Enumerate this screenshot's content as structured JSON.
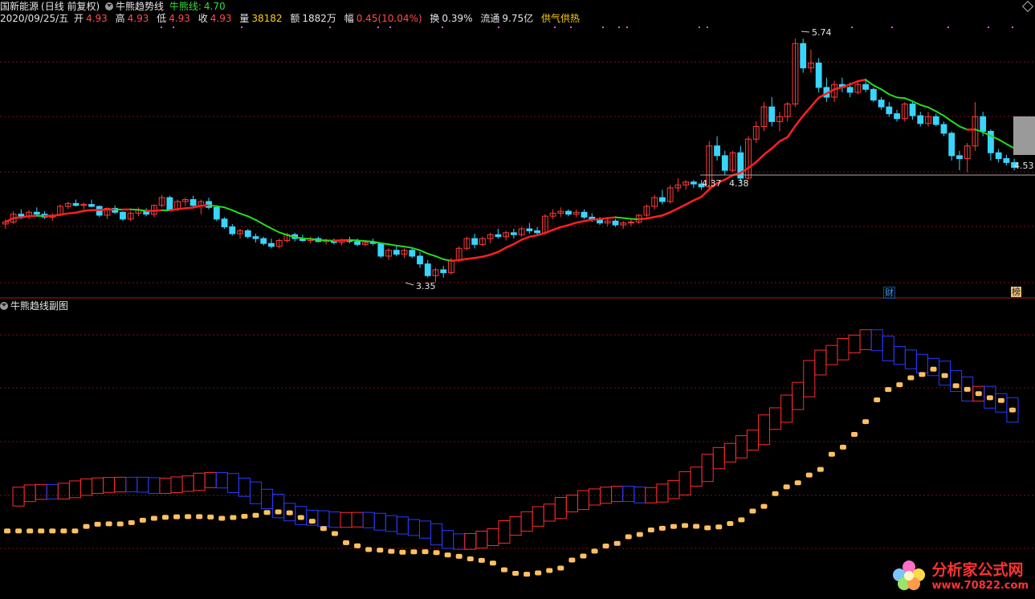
{
  "header": {
    "stock_name": "国新能源",
    "period": "(日线 前复权)",
    "indicator": "牛熊趋势线",
    "indicator_line_label": "牛熊线:",
    "indicator_line_value": "4.70",
    "date": "2020/09/25/五",
    "open_label": "开",
    "open": "4.93",
    "high_label": "高",
    "high": "4.93",
    "low_label": "低",
    "low": "4.93",
    "close_label": "收",
    "close": "4.93",
    "volume_label": "量",
    "volume": "38182",
    "amount_label": "额",
    "amount": "1882万",
    "change_label": "幅",
    "change": "0.45(10.04%)",
    "turnover_label": "换",
    "turnover": "0.39%",
    "float_label": "流通",
    "float": "9.75亿",
    "extra": "供气供热"
  },
  "sub_panel": {
    "title": "牛熊趋线副图"
  },
  "price_labels": {
    "high": "5.74",
    "low": "3.35",
    "mark_a": "4.37",
    "mark_b": "4.38",
    "last": "4.53"
  },
  "badges": {
    "cai": "财",
    "rank": "榜"
  },
  "watermark": {
    "title": "分析家公式网",
    "url": "www.70822.com"
  },
  "colors": {
    "up": "#ff3b3b",
    "down": "#39d5ff",
    "bull_line": "#ff2020",
    "bear_line": "#22dd22",
    "sub_up": "#ff2a2a",
    "sub_down": "#2a3aff",
    "sub_signal": "#ffc060",
    "grid": "#7a1414"
  },
  "chart_data": {
    "type": "candlestick",
    "y_range": [
      3.2,
      5.95
    ],
    "grid": true,
    "candles": [
      [
        3.95,
        4.0,
        3.9,
        3.97
      ],
      [
        3.97,
        4.08,
        3.95,
        4.05
      ],
      [
        4.05,
        4.1,
        4.0,
        4.03
      ],
      [
        4.03,
        4.09,
        4.0,
        4.07
      ],
      [
        4.07,
        4.12,
        4.03,
        4.05
      ],
      [
        4.05,
        4.08,
        4.0,
        4.02
      ],
      [
        4.02,
        4.06,
        3.98,
        4.04
      ],
      [
        4.04,
        4.15,
        4.03,
        4.13
      ],
      [
        4.13,
        4.18,
        4.1,
        4.16
      ],
      [
        4.16,
        4.2,
        4.13,
        4.14
      ],
      [
        4.14,
        4.17,
        4.1,
        4.15
      ],
      [
        4.15,
        4.2,
        4.12,
        4.13
      ],
      [
        4.13,
        4.14,
        4.02,
        4.04
      ],
      [
        4.04,
        4.12,
        4.0,
        4.11
      ],
      [
        4.11,
        4.14,
        4.05,
        4.07
      ],
      [
        4.07,
        4.08,
        3.98,
        4.0
      ],
      [
        4.0,
        4.08,
        3.98,
        4.06
      ],
      [
        4.06,
        4.12,
        4.03,
        4.09
      ],
      [
        4.09,
        4.11,
        4.03,
        4.05
      ],
      [
        4.05,
        4.15,
        4.02,
        4.14
      ],
      [
        4.14,
        4.25,
        4.12,
        4.22
      ],
      [
        4.22,
        4.24,
        4.08,
        4.1
      ],
      [
        4.1,
        4.2,
        4.08,
        4.18
      ],
      [
        4.18,
        4.22,
        4.13,
        4.2
      ],
      [
        4.2,
        4.24,
        4.12,
        4.14
      ],
      [
        4.14,
        4.2,
        4.05,
        4.18
      ],
      [
        4.18,
        4.22,
        4.1,
        4.12
      ],
      [
        4.12,
        4.13,
        3.98,
        4.0
      ],
      [
        4.0,
        4.02,
        3.9,
        3.92
      ],
      [
        3.92,
        3.95,
        3.83,
        3.85
      ],
      [
        3.85,
        3.9,
        3.8,
        3.88
      ],
      [
        3.88,
        3.9,
        3.8,
        3.82
      ],
      [
        3.82,
        3.85,
        3.76,
        3.8
      ],
      [
        3.8,
        3.82,
        3.73,
        3.75
      ],
      [
        3.75,
        3.8,
        3.7,
        3.72
      ],
      [
        3.72,
        3.8,
        3.7,
        3.78
      ],
      [
        3.78,
        3.86,
        3.76,
        3.84
      ],
      [
        3.84,
        3.86,
        3.77,
        3.8
      ],
      [
        3.8,
        3.84,
        3.77,
        3.78
      ],
      [
        3.78,
        3.82,
        3.75,
        3.8
      ],
      [
        3.8,
        3.82,
        3.76,
        3.77
      ],
      [
        3.77,
        3.8,
        3.74,
        3.78
      ],
      [
        3.78,
        3.8,
        3.74,
        3.76
      ],
      [
        3.76,
        3.8,
        3.73,
        3.78
      ],
      [
        3.78,
        3.82,
        3.75,
        3.77
      ],
      [
        3.77,
        3.8,
        3.72,
        3.74
      ],
      [
        3.74,
        3.78,
        3.72,
        3.76
      ],
      [
        3.76,
        3.8,
        3.73,
        3.75
      ],
      [
        3.75,
        3.76,
        3.6,
        3.62
      ],
      [
        3.62,
        3.7,
        3.58,
        3.68
      ],
      [
        3.68,
        3.72,
        3.62,
        3.64
      ],
      [
        3.64,
        3.7,
        3.6,
        3.68
      ],
      [
        3.68,
        3.7,
        3.6,
        3.62
      ],
      [
        3.62,
        3.66,
        3.5,
        3.54
      ],
      [
        3.54,
        3.58,
        3.4,
        3.42
      ],
      [
        3.42,
        3.5,
        3.35,
        3.48
      ],
      [
        3.48,
        3.52,
        3.4,
        3.45
      ],
      [
        3.45,
        3.6,
        3.43,
        3.58
      ],
      [
        3.58,
        3.72,
        3.56,
        3.7
      ],
      [
        3.7,
        3.82,
        3.68,
        3.8
      ],
      [
        3.8,
        3.85,
        3.7,
        3.74
      ],
      [
        3.74,
        3.82,
        3.72,
        3.8
      ],
      [
        3.8,
        3.86,
        3.75,
        3.84
      ],
      [
        3.84,
        3.9,
        3.8,
        3.82
      ],
      [
        3.82,
        3.88,
        3.78,
        3.86
      ],
      [
        3.86,
        3.9,
        3.8,
        3.84
      ],
      [
        3.84,
        3.92,
        3.82,
        3.9
      ],
      [
        3.9,
        3.96,
        3.85,
        3.88
      ],
      [
        3.88,
        3.92,
        3.84,
        3.86
      ],
      [
        3.86,
        4.05,
        3.84,
        4.03
      ],
      [
        4.03,
        4.1,
        4.0,
        4.06
      ],
      [
        4.06,
        4.12,
        4.02,
        4.08
      ],
      [
        4.08,
        4.1,
        4.03,
        4.05
      ],
      [
        4.05,
        4.1,
        4.02,
        4.07
      ],
      [
        4.07,
        4.1,
        4.0,
        4.02
      ],
      [
        4.02,
        4.06,
        3.97,
        3.99
      ],
      [
        3.99,
        4.02,
        3.94,
        3.96
      ],
      [
        3.96,
        4.0,
        3.93,
        3.98
      ],
      [
        3.98,
        4.0,
        3.92,
        3.94
      ],
      [
        3.94,
        3.98,
        3.9,
        3.96
      ],
      [
        3.96,
        4.0,
        3.93,
        3.97
      ],
      [
        3.97,
        4.05,
        3.95,
        4.04
      ],
      [
        4.04,
        4.15,
        4.02,
        4.13
      ],
      [
        4.13,
        4.25,
        4.1,
        4.22
      ],
      [
        4.22,
        4.3,
        4.15,
        4.18
      ],
      [
        4.18,
        4.35,
        4.16,
        4.32
      ],
      [
        4.32,
        4.42,
        4.28,
        4.35
      ],
      [
        4.35,
        4.4,
        4.3,
        4.38
      ],
      [
        4.38,
        4.4,
        4.32,
        4.36
      ],
      [
        4.36,
        4.4,
        4.3,
        4.33
      ],
      [
        4.33,
        4.8,
        4.3,
        4.75
      ],
      [
        4.75,
        4.85,
        4.6,
        4.65
      ],
      [
        4.65,
        4.7,
        4.45,
        4.5
      ],
      [
        4.5,
        4.7,
        4.48,
        4.68
      ],
      [
        4.68,
        4.75,
        4.38,
        4.42
      ],
      [
        4.42,
        4.85,
        4.4,
        4.82
      ],
      [
        4.82,
        5.0,
        4.78,
        4.95
      ],
      [
        4.95,
        5.2,
        4.9,
        5.15
      ],
      [
        5.15,
        5.25,
        4.95,
        5.0
      ],
      [
        5.0,
        5.1,
        4.9,
        5.05
      ],
      [
        5.05,
        5.2,
        5.0,
        5.18
      ],
      [
        5.18,
        5.85,
        5.15,
        5.8
      ],
      [
        5.8,
        5.85,
        5.5,
        5.55
      ],
      [
        5.55,
        5.74,
        5.5,
        5.6
      ],
      [
        5.6,
        5.65,
        5.3,
        5.35
      ],
      [
        5.35,
        5.45,
        5.2,
        5.25
      ],
      [
        5.25,
        5.42,
        5.2,
        5.38
      ],
      [
        5.38,
        5.45,
        5.3,
        5.35
      ],
      [
        5.35,
        5.4,
        5.25,
        5.3
      ],
      [
        5.3,
        5.42,
        5.28,
        5.38
      ],
      [
        5.38,
        5.42,
        5.3,
        5.33
      ],
      [
        5.33,
        5.35,
        5.2,
        5.22
      ],
      [
        5.22,
        5.25,
        5.12,
        5.15
      ],
      [
        5.15,
        5.2,
        5.05,
        5.08
      ],
      [
        5.08,
        5.12,
        5.0,
        5.03
      ],
      [
        5.03,
        5.2,
        5.0,
        5.18
      ],
      [
        5.18,
        5.2,
        5.02,
        5.06
      ],
      [
        5.06,
        5.1,
        4.95,
        4.98
      ],
      [
        4.98,
        5.1,
        4.95,
        5.05
      ],
      [
        5.05,
        5.08,
        4.95,
        4.97
      ],
      [
        4.97,
        5.0,
        4.85,
        4.88
      ],
      [
        4.88,
        4.9,
        4.6,
        4.65
      ],
      [
        4.65,
        4.7,
        4.5,
        4.62
      ],
      [
        4.62,
        4.78,
        4.48,
        4.75
      ],
      [
        4.75,
        5.2,
        4.7,
        5.05
      ],
      [
        5.05,
        5.1,
        4.85,
        4.9
      ],
      [
        4.9,
        4.92,
        4.6,
        4.68
      ],
      [
        4.68,
        4.72,
        4.58,
        4.62
      ],
      [
        4.62,
        4.66,
        4.55,
        4.58
      ],
      [
        4.58,
        4.62,
        4.5,
        4.53
      ]
    ]
  }
}
